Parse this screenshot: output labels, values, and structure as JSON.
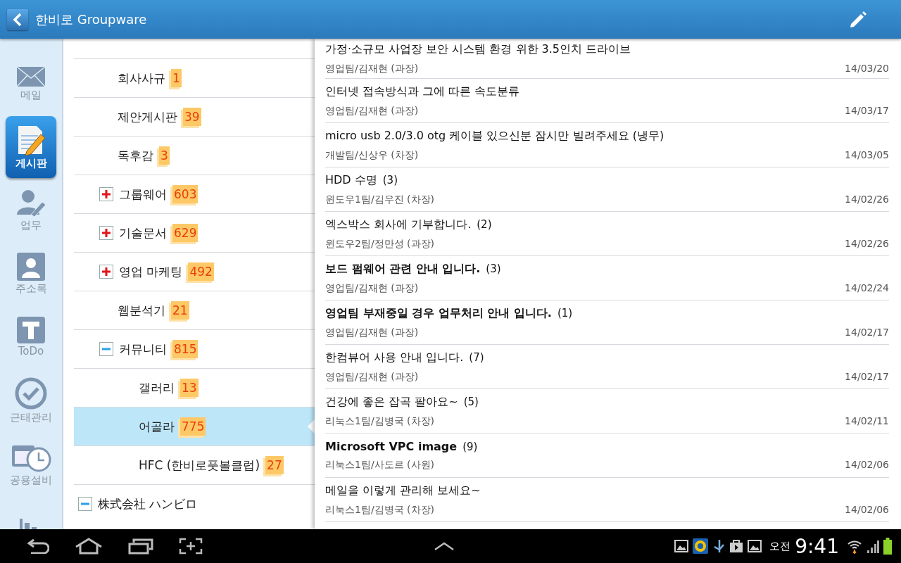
{
  "app_bar": {
    "title": "한비로 Groupware"
  },
  "rail": [
    {
      "kind": "mail",
      "label": "메일",
      "selected": false
    },
    {
      "kind": "board",
      "label": "게시판",
      "selected": true
    },
    {
      "kind": "task",
      "label": "업무",
      "selected": false
    },
    {
      "kind": "contacts",
      "label": "주소록",
      "selected": false
    },
    {
      "kind": "todo",
      "label": "ToDo",
      "selected": false
    },
    {
      "kind": "attendance",
      "label": "근태관리",
      "selected": false
    },
    {
      "kind": "facility",
      "label": "공용설비",
      "selected": false
    },
    {
      "kind": "stats",
      "selected": false
    }
  ],
  "tree": [
    {
      "children": [
        {
          "label": "회사사규",
          "count": "1",
          "selected": false
        },
        {
          "label": "제안게시판",
          "count": "39",
          "selected": false
        },
        {
          "label": "독후감",
          "count": "3",
          "selected": false
        },
        {
          "label": "그룹웨어",
          "count": "603",
          "expanded": false,
          "selected": false
        },
        {
          "label": "기술문서",
          "count": "629",
          "expanded": false,
          "selected": false
        },
        {
          "label": "영업 마케팅",
          "count": "492",
          "expanded": false,
          "selected": false
        },
        {
          "label": "웹분석기",
          "count": "21",
          "selected": false
        },
        {
          "label": "커뮤니티",
          "count": "815",
          "expanded": true,
          "selected": false,
          "children": [
            {
              "label": "갤러리",
              "count": "13",
              "selected": false
            },
            {
              "label": "어골라",
              "count": "775",
              "selected": true
            },
            {
              "label": "HFC (한비로풋볼클럽)",
              "count": "27",
              "selected": false
            }
          ]
        }
      ]
    },
    {
      "label": "株式会社 ハンビロ",
      "expanded": true,
      "selected": false
    }
  ],
  "posts": [
    {
      "title": "가정·소규모 사업장 보안 시스템 환경 위한 3.5인치 드라이브",
      "unread": false,
      "author": "영업팀/김재현 (과장)",
      "date": "14/03/20"
    },
    {
      "title": "인터넷 접속방식과 그에 따른 속도분류",
      "unread": false,
      "author": "영업팀/김재현 (과장)",
      "date": "14/03/17"
    },
    {
      "title": "micro usb 2.0/3.0 otg 케이블 있으신분 잠시만 빌려주세요 (냉무)",
      "unread": false,
      "author": "개발팀/신상우 (차장)",
      "date": "14/03/05"
    },
    {
      "title": "HDD 수명",
      "comments": "(3)",
      "unread": false,
      "author": "윈도우1팀/김우진 (차장)",
      "date": "14/02/26"
    },
    {
      "title": "엑스박스 회사에 기부합니다.",
      "comments": "(2)",
      "unread": false,
      "author": "윈도우2팀/정만성 (과장)",
      "date": "14/02/26"
    },
    {
      "title": "보드 펌웨어 관련 안내 입니다.",
      "comments": "(3)",
      "unread": true,
      "author": "영업팀/김재현 (과장)",
      "date": "14/02/24"
    },
    {
      "title": "영업팀 부재중일 경우 업무처리 안내 입니다.",
      "comments": "(1)",
      "unread": true,
      "author": "영업팀/김재현 (과장)",
      "date": "14/02/17"
    },
    {
      "title": "한컴뷰어 사용 안내 입니다.",
      "comments": "(7)",
      "unread": false,
      "author": "영업팀/김재현 (과장)",
      "date": "14/02/17"
    },
    {
      "title": "건강에 좋은 잡곡 팔아요~",
      "comments": "(5)",
      "unread": false,
      "author": "리눅스1팀/김병국 (차장)",
      "date": "14/02/11"
    },
    {
      "title": "Microsoft VPC image",
      "comments": "(9)",
      "unread": true,
      "author": "리눅스1팀/사도르 (사원)",
      "date": "14/02/06"
    },
    {
      "title": "메일을 이렇게 관리해 보세요~",
      "unread": false,
      "author": "리눅스1팀/김병국 (차장)",
      "date": "14/02/06"
    }
  ],
  "system_bar": {
    "period": "오전",
    "time": "9:41"
  }
}
